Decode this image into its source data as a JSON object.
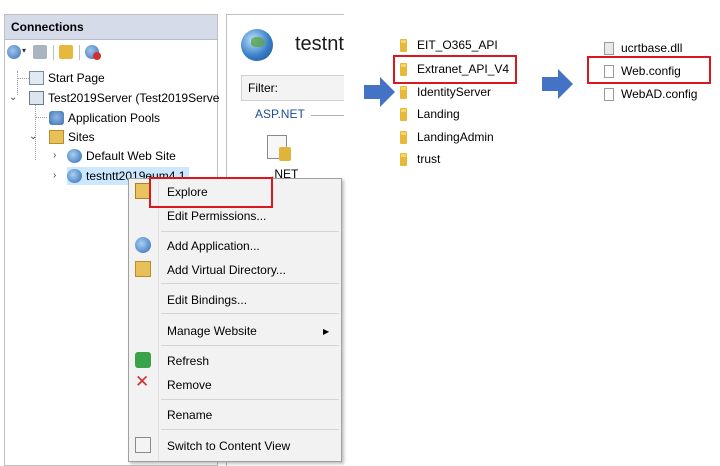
{
  "connections": {
    "title": "Connections",
    "tree": {
      "start_page": "Start Page",
      "server": "Test2019Server (Test2019Serve",
      "app_pools": "Application Pools",
      "sites": "Sites",
      "default_site": "Default Web Site",
      "selected_site": "testntt2019eum4.1"
    }
  },
  "middle": {
    "title": "testnt",
    "filter_label": "Filter:",
    "section": "ASP.NET",
    "icon_label": ".NET"
  },
  "context_menu": {
    "items": [
      {
        "label": "Explore",
        "icon": "explore-icon"
      },
      {
        "label": "Edit Permissions...",
        "icon": ""
      },
      {
        "label": "Add Application...",
        "icon": "add-application-icon"
      },
      {
        "label": "Add Virtual Directory...",
        "icon": "add-virtual-directory-icon"
      },
      {
        "label": "Edit Bindings...",
        "icon": ""
      },
      {
        "label": "Manage Website",
        "icon": ""
      },
      {
        "label": "Refresh",
        "icon": "refresh-icon"
      },
      {
        "label": "Remove",
        "icon": "remove-icon"
      },
      {
        "label": "Rename",
        "icon": ""
      },
      {
        "label": "Switch to Content View",
        "icon": "content-view-icon"
      }
    ],
    "submenu_arrow": "▶"
  },
  "folders": [
    "EIT_O365_API",
    "Extranet_API_V4",
    "IdentityServer",
    "Landing",
    "LandingAdmin",
    "trust"
  ],
  "files": [
    "ucrtbase.dll",
    "Web.config",
    "WebAD.config"
  ],
  "colors": {
    "highlight_box": "#d9171e",
    "arrow": "#4472c4",
    "folder": "#e8b83a",
    "header_bg": "#d6dbe9"
  }
}
